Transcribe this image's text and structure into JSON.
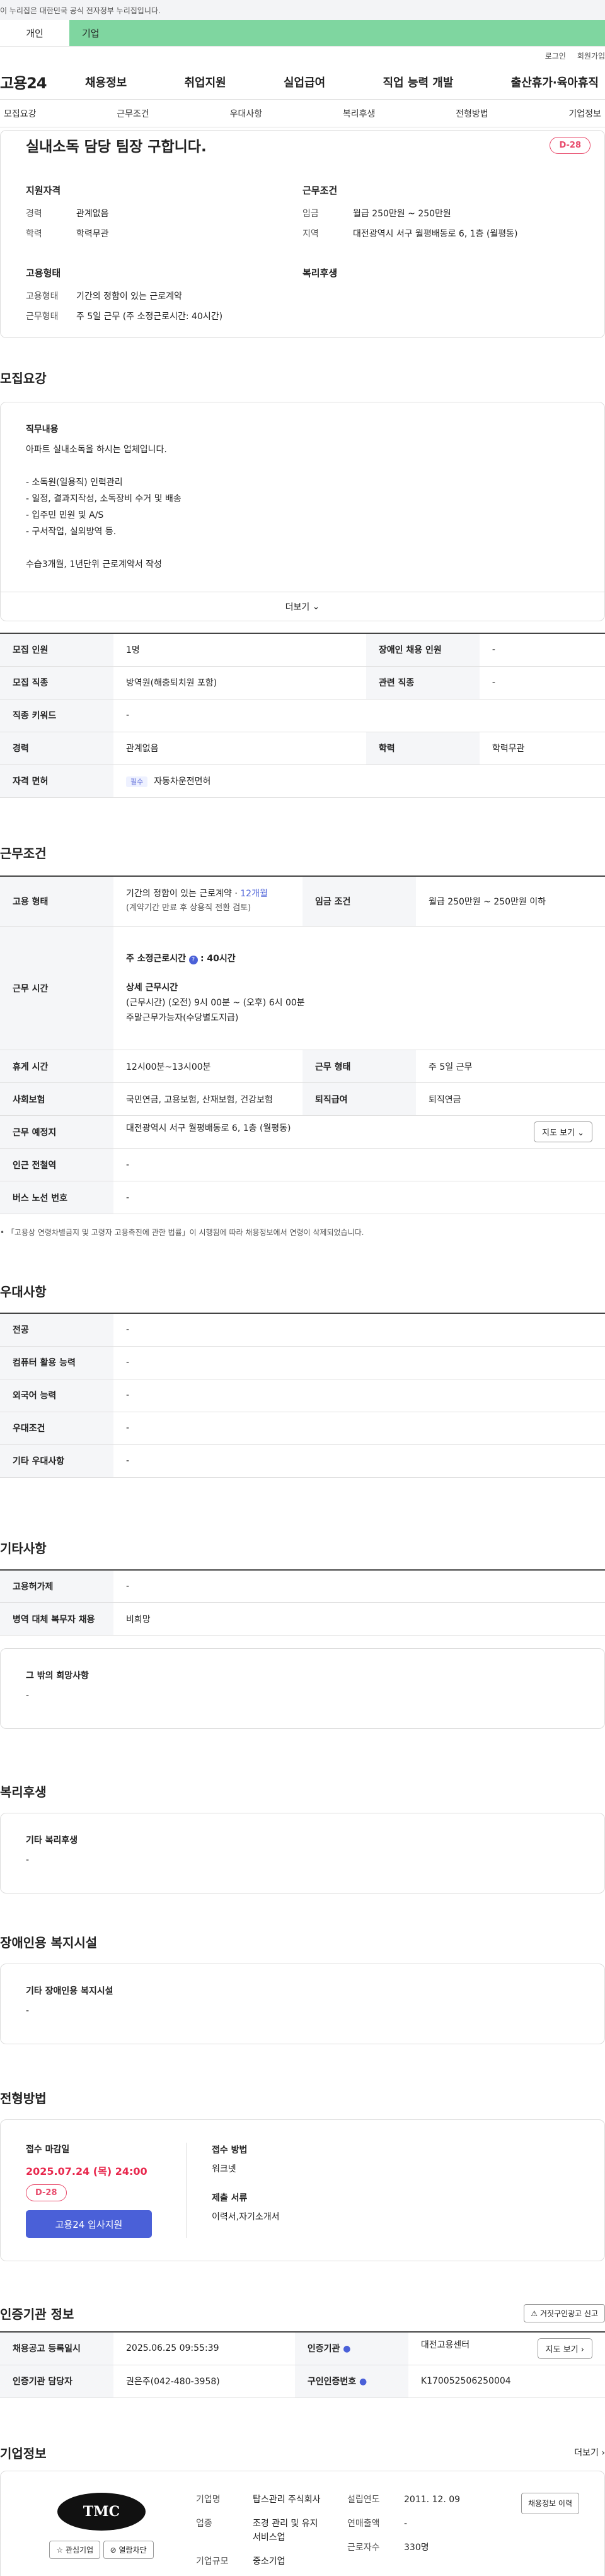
{
  "gov_banner": "이 누리집은 대한민국 공식 전자정부 누리집입니다.",
  "user_tabs": [
    "개인",
    "기업"
  ],
  "util": [
    "로그인",
    "회원가입"
  ],
  "logo": "고용24",
  "gnb": [
    "채용정보",
    "취업지원",
    "실업급여",
    "직업 능력 개발",
    "출산휴가·육아휴직"
  ],
  "subnav": [
    "모집요강",
    "근무조건",
    "우대사항",
    "복리후생",
    "전형방법",
    "기업정보"
  ],
  "job": {
    "title": "실내소독 담당 팀장 구합니다.",
    "dday": "D-28",
    "qual_h": "지원자격",
    "qual": [
      [
        "경력",
        "관계없음"
      ],
      [
        "학력",
        "학력무관"
      ]
    ],
    "cond_h": "근무조건",
    "cond": [
      [
        "임금",
        "월급 250만원 ~ 250만원"
      ],
      [
        "지역",
        "대전광역시 서구 월평배동로 6, 1층 (월평동)"
      ]
    ],
    "emp_h": "고용형태",
    "emp": [
      [
        "고용형태",
        "기간의 정함이 있는 근로계약"
      ],
      [
        "근무형태",
        "주 5일 근무 (주 소정근로시간: 40시간)"
      ]
    ],
    "welfare_h": "복리후생"
  },
  "recruit": {
    "title": "모집요강",
    "duty_h": "직무내용",
    "duty": [
      "아파트 실내소독을 하시는 업체입니다.",
      "",
      "- 소독원(일용직) 인력관리",
      "- 일정, 결과지작성, 소독장비 수거 및 배송",
      "- 입주민 민원 및 A/S",
      "- 구서작업, 실외방역 등.",
      "",
      "수습3개월, 1년단위 근로계약서 작성"
    ],
    "more": "더보기",
    "rows": [
      [
        "모집 인원",
        "1명",
        "장애인 채용 인원",
        "-"
      ],
      [
        "모집 직종",
        "방역원(해충퇴치원 포함)",
        "관련 직종",
        "-"
      ],
      [
        "직종 키워드",
        "-",
        "",
        ""
      ],
      [
        "경력",
        "관계없음",
        "학력",
        "학력무관"
      ]
    ],
    "license_k": "자격 면허",
    "license_badge": "필수",
    "license": "자동차운전면허"
  },
  "work": {
    "title": "근무조건",
    "emp_k": "고용 형태",
    "emp_v1": "기간의 정함이 있는 근로계약 ·",
    "emp_months": "12개월",
    "emp_v2": "(계약기간 만료 후 상용직 전환 검토)",
    "wage_k": "임금 조건",
    "wage_v": "월급 250만원 ~ 250만원 이하",
    "time_k": "근무 시간",
    "time_h": "주 소정근로시간",
    "time_hv": ": 40시간",
    "detail_h": "상세 근무시간",
    "detail1": "(근무시간) (오전) 9시 00분 ~ (오후) 6시 00분",
    "detail2": "주말근무가능자(수당별도지급)",
    "rows": [
      [
        "휴게 시간",
        "12시00분~13시00분",
        "근무 형태",
        "주 5일 근무"
      ],
      [
        "사회보험",
        "국민연금, 고용보험, 산재보험, 건강보험",
        "퇴직급여",
        "퇴직연금"
      ]
    ],
    "place_k": "근무 예정지",
    "place_v": "대전광역시 서구 월평배동로 6, 1층 (월평동)",
    "map_btn": "지도 보기",
    "sub_k": "인근 전철역",
    "sub_v": "-",
    "bus_k": "버스 노선 번호",
    "bus_v": "-",
    "note": "「고용상 연령차별금지 및 고령자 고용촉진에 관한 법률」이 시행됨에 따라 채용정보에서 연령이 삭제되었습니다."
  },
  "pref": {
    "title": "우대사항",
    "rows": [
      [
        "전공",
        "-"
      ],
      [
        "컴퓨터 활용 능력",
        "-"
      ],
      [
        "외국어 능력",
        "-"
      ],
      [
        "우대조건",
        "-"
      ],
      [
        "기타 우대사항",
        "-"
      ]
    ]
  },
  "etc": {
    "title": "기타사항",
    "rows": [
      [
        "고용허가제",
        "-"
      ],
      [
        "병역 대체 복무자 채용",
        "비희망"
      ]
    ],
    "wish_h": "그 밖의 희망사항",
    "wish_v": "-"
  },
  "welfare": {
    "title": "복리후생",
    "h": "기타 복리후생",
    "v": "-"
  },
  "disabled": {
    "title": "장애인용 복지시설",
    "h": "기타 장애인용 복지시설",
    "v": "-"
  },
  "apply": {
    "title": "전형방법",
    "deadline_h": "접수 마감일",
    "deadline": "2025.07.24 (목) 24:00",
    "dday": "D-28",
    "btn": "고용24 입사지원",
    "method_h": "접수 방법",
    "method": "워크넷",
    "docs_h": "제출 서류",
    "docs": "이력서,자기소개서"
  },
  "cert": {
    "title": "인증기관 정보",
    "report": "거짓구인광고 신고",
    "rows": [
      [
        "채용공고 등록일시",
        "2025.06.25 09:55:39",
        "인증기관",
        "대전고용센터"
      ],
      [
        "인증기관 담당자",
        "권은주(042-480-3958)",
        "구인인증번호",
        "K170052506250004"
      ]
    ],
    "map_btn": "지도 보기"
  },
  "company": {
    "title": "기업정보",
    "more": "더보기",
    "logo": "TMC",
    "fav": "관심기업",
    "block": "열람차단",
    "fields": [
      [
        "기업명",
        "탑스관리 주식회사"
      ],
      [
        "업종",
        "조경 관리 및 유지 서비스업"
      ],
      [
        "기업규모",
        "중소기업"
      ]
    ],
    "fields2": [
      [
        "설립연도",
        "2011. 12. 09"
      ],
      [
        "연매출액",
        "-"
      ],
      [
        "근로자수",
        "330명"
      ]
    ],
    "history_btn": "채용정보 이력"
  },
  "colors": {
    "accent": "#4a60d8",
    "dday": "#e84a6b",
    "tab": "#7fd6a0"
  }
}
